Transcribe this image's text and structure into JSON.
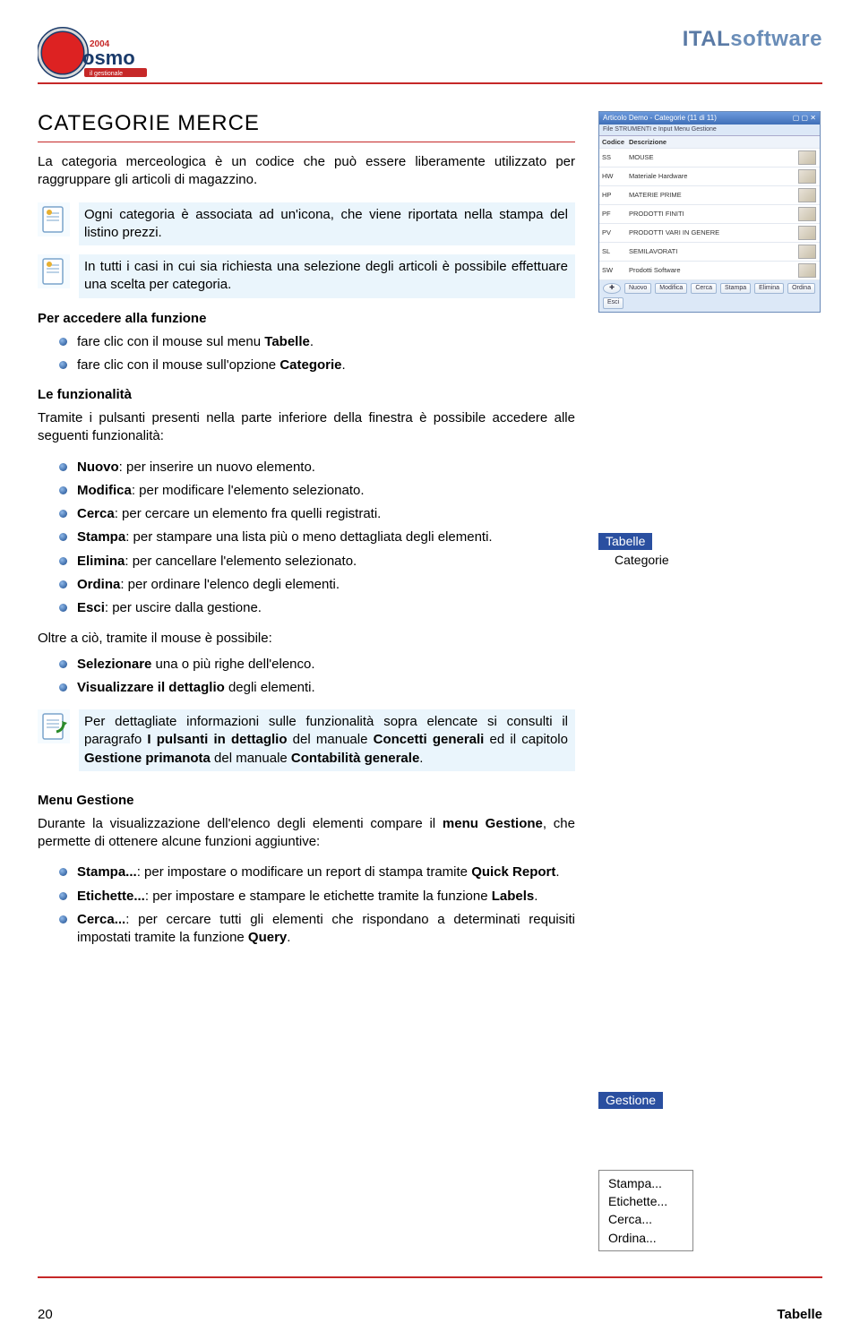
{
  "header": {
    "logo_right_a": "ITAL",
    "logo_right_b": "software"
  },
  "title": "CATEGORIE MERCE",
  "intro": "La categoria merceologica è un codice che può essere liberamente utilizzato per raggruppare gli articoli di magazzino.",
  "note1": "Ogni categoria è associata ad un'icona, che viene riportata nella stampa del listino prezzi.",
  "note2": "In tutti i casi in cui sia richiesta una selezione degli articoli è possibile effettuare una scelta per categoria.",
  "access": {
    "heading": "Per accedere alla funzione",
    "items": [
      {
        "pre": "fare clic con il mouse sul menu ",
        "bold": "Tabelle",
        "post": "."
      },
      {
        "pre": "fare clic con il mouse sull'opzione ",
        "bold": "Categorie",
        "post": "."
      }
    ]
  },
  "func": {
    "heading": "Le funzionalità",
    "intro": "Tramite i pulsanti presenti nella parte inferiore della finestra è possibile accedere alle seguenti funzionalità:",
    "items": [
      {
        "bold": "Nuovo",
        "text": ": per inserire un nuovo elemento."
      },
      {
        "bold": "Modifica",
        "text": ": per modificare l'elemento selezionato."
      },
      {
        "bold": "Cerca",
        "text": ": per cercare un elemento fra quelli registrati."
      },
      {
        "bold": "Stampa",
        "text": ": per stampare una lista più o meno dettagliata degli elementi."
      },
      {
        "bold": "Elimina",
        "text": ": per cancellare l'elemento selezionato."
      },
      {
        "bold": "Ordina",
        "text": ": per ordinare l'elenco degli elementi."
      },
      {
        "bold": "Esci",
        "text": ": per uscire dalla gestione."
      }
    ],
    "extra_intro": "Oltre a ciò, tramite il mouse è possibile:",
    "extra_items": [
      {
        "bold": "Selezionare",
        "text": " una o più righe dell'elenco."
      },
      {
        "bold": "Visualizzare il dettaglio",
        "text": " degli elementi."
      }
    ]
  },
  "note3_a": "Per dettagliate informazioni sulle funzionalità sopra elencate si consulti il paragrafo ",
  "note3_b": "I pulsanti in dettaglio",
  "note3_c": " del manuale ",
  "note3_d": "Concetti generali",
  "note3_e": " ed il capitolo ",
  "note3_f": "Gestione primanota",
  "note3_g": " del manuale ",
  "note3_h": "Contabilità generale",
  "note3_i": ".",
  "gestione": {
    "heading": "Menu Gestione",
    "intro_a": "Durante la visualizzazione dell'elenco degli elementi compare il ",
    "intro_b": "menu Gestione",
    "intro_c": ", che permette di ottenere alcune funzioni aggiuntive:",
    "items": [
      {
        "bold": "Stampa...",
        "text": ": per impostare o modificare un report di stampa tramite ",
        "bold2": "Quick Report",
        "post": "."
      },
      {
        "bold": "Etichette...",
        "text": ": per impostare e stampare le etichette tramite la funzione ",
        "bold2": "Labels",
        "post": "."
      },
      {
        "bold": "Cerca...",
        "text": ": per cercare tutti gli elementi che rispondano a determinati requisiti impostati tramite la funzione ",
        "bold2": "Query",
        "post": "."
      }
    ]
  },
  "side": {
    "window_title": "Articolo Demo - Categorie (11 di 11)",
    "toolbar": "File   STRUMENTI e Input   Menu   Gestione",
    "cols": {
      "a": "Codice",
      "b": "Descrizione"
    },
    "rows": [
      {
        "code": "SS",
        "desc": "MOUSE"
      },
      {
        "code": "HW",
        "desc": "Materiale Hardware"
      },
      {
        "code": "HP",
        "desc": "MATERIE PRIME"
      },
      {
        "code": "PF",
        "desc": "PRODOTTI FINITI"
      },
      {
        "code": "PV",
        "desc": "PRODOTTI VARI IN GENERE"
      },
      {
        "code": "SL",
        "desc": "SEMILAVORATI"
      },
      {
        "code": "SW",
        "desc": "Prodotti Software"
      }
    ],
    "buttons": [
      "Nuovo",
      "Modifica",
      "Cerca",
      "Stampa",
      "Elimina",
      "Ordina",
      "Esci"
    ],
    "menu1_label": "Tabelle",
    "menu1_item": "Categorie",
    "menu2_label": "Gestione",
    "menu2_items": [
      "Stampa...",
      "Etichette...",
      "Cerca...",
      "Ordina..."
    ]
  },
  "footer": {
    "left": "20",
    "right": "Tabelle"
  }
}
